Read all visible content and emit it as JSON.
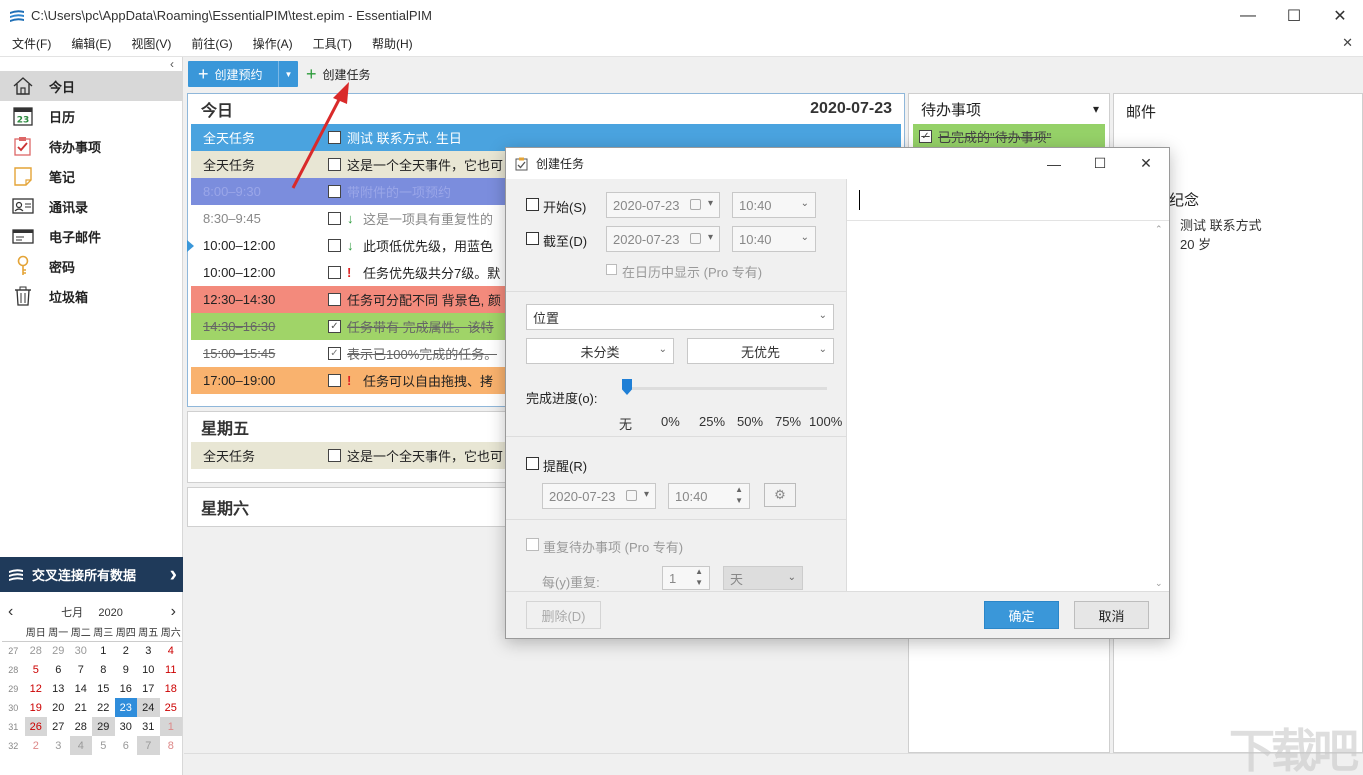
{
  "window": {
    "title": "C:\\Users\\pc\\AppData\\Roaming\\EssentialPIM\\test.epim - EssentialPIM",
    "minimize": "—",
    "maximize": "☐",
    "close": "✕"
  },
  "menu": [
    "文件(F)",
    "编辑(E)",
    "视图(V)",
    "前往(G)",
    "操作(A)",
    "工具(T)",
    "帮助(H)"
  ],
  "menu_close": "✕",
  "sidebar": {
    "collapse": "‹",
    "items": [
      {
        "label": "今日",
        "icon": "home-icon"
      },
      {
        "label": "日历",
        "icon": "calendar-icon",
        "badge": "23"
      },
      {
        "label": "待办事项",
        "icon": "todo-icon"
      },
      {
        "label": "笔记",
        "icon": "note-icon"
      },
      {
        "label": "通讯录",
        "icon": "contacts-icon"
      },
      {
        "label": "电子邮件",
        "icon": "email-icon"
      },
      {
        "label": "密码",
        "icon": "key-icon"
      },
      {
        "label": "垃圾箱",
        "icon": "trash-icon"
      }
    ],
    "sync_label": "交叉连接所有数据",
    "sync_arrow": "›"
  },
  "mini_calendar": {
    "prev": "‹",
    "next": "›",
    "month": "七月",
    "year": "2020",
    "weekdays": [
      "周日",
      "周一",
      "周二",
      "周三",
      "周四",
      "周五",
      "周六"
    ],
    "weeks": [
      {
        "wk": "27",
        "days": [
          "28",
          "29",
          "30",
          "1",
          "2",
          "3",
          "4"
        ]
      },
      {
        "wk": "28",
        "days": [
          "5",
          "6",
          "7",
          "8",
          "9",
          "10",
          "11"
        ]
      },
      {
        "wk": "29",
        "days": [
          "12",
          "13",
          "14",
          "15",
          "16",
          "17",
          "18"
        ]
      },
      {
        "wk": "30",
        "days": [
          "19",
          "20",
          "21",
          "22",
          "23",
          "24",
          "25"
        ]
      },
      {
        "wk": "31",
        "days": [
          "26",
          "27",
          "28",
          "29",
          "30",
          "31",
          "1"
        ]
      },
      {
        "wk": "32",
        "days": [
          "2",
          "3",
          "4",
          "5",
          "6",
          "7",
          "8"
        ]
      }
    ]
  },
  "toolbar": {
    "new_appointment": "创建预约",
    "new_task": "创建任务"
  },
  "today": {
    "title": "今日",
    "date": "2020-07-23",
    "rows": [
      {
        "time": "全天任务",
        "text": "测试 联系方式. 生日",
        "bg": "#4aa3df",
        "color": "#ffffff",
        "checked": false,
        "priority": ""
      },
      {
        "time": "全天任务",
        "text": "这是一个全天事件，它也可",
        "bg": "#e8e6d4",
        "color": "#222222",
        "checked": false,
        "priority": ""
      },
      {
        "time": "8:00–9:30",
        "text": "带附件的一项预约",
        "bg": "#7b8ddd",
        "color": "#9aa6e8",
        "checked": false,
        "priority": ""
      },
      {
        "time": "8:30–9:45",
        "text": "这是一项具有重复性的",
        "bg": "#ffffff",
        "color": "#888888",
        "checked": false,
        "priority": "↓"
      },
      {
        "time": "10:00–12:00",
        "text": "此项低优先级，用蓝色",
        "bg": "#ffffff",
        "color": "#222222",
        "checked": false,
        "priority": "↓"
      },
      {
        "time": "10:00–12:00",
        "text": "任务优先级共分7级。默",
        "bg": "#ffffff",
        "color": "#222222",
        "checked": false,
        "priority": "!"
      },
      {
        "time": "12:30–14:30",
        "text": "任务可分配不同 背景色, 颜",
        "bg": "#f38a7c",
        "color": "#222222",
        "checked": false,
        "priority": ""
      },
      {
        "time": "14:30–16:30",
        "text": "任务带有 完成属性。该特",
        "bg": "#a0d468",
        "color": "#555555",
        "checked": true,
        "priority": "",
        "strike": true
      },
      {
        "time": "15:00–15:45",
        "text": "表示已100%完成的任务。",
        "bg": "#ffffff",
        "color": "#777777",
        "checked": true,
        "priority": "",
        "strike": true
      },
      {
        "time": "17:00–19:00",
        "text": "任务可以自由拖拽、拷",
        "bg": "#f9b26e",
        "color": "#222222",
        "checked": false,
        "priority": "!"
      }
    ]
  },
  "friday": {
    "title": "星期五",
    "row_time": "全天任务",
    "row_text": "这是一个全天事件，它也可"
  },
  "saturday": {
    "title": "星期六"
  },
  "todo_panel": {
    "title": "待办事项",
    "dropdown": "▾",
    "item": "已完成的\"待办事项\"",
    "check": "✓"
  },
  "mail_panel": {
    "title": "邮件",
    "anniversary": "纪念",
    "contact": "测试 联系方式",
    "age": "20 岁"
  },
  "dialog": {
    "title": "创建任务",
    "minimize": "—",
    "maximize": "☐",
    "close": "✕",
    "start_label": "开始(S)",
    "start_date": "2020-07-23",
    "start_time": "10:40",
    "due_label": "截至(D)",
    "due_date": "2020-07-23",
    "due_time": "10:40",
    "show_in_calendar": "在日历中显示 (Pro 专有)",
    "location_placeholder": "位置",
    "category": "未分类",
    "priority": "无优先",
    "progress_label": "完成进度(o):",
    "progress_value": 0,
    "progress_ticks": [
      "无",
      "0%",
      "25%",
      "50%",
      "75%",
      "100%"
    ],
    "reminder_label": "提醒(R)",
    "reminder_date": "2020-07-23",
    "reminder_time": "10:40",
    "repeat_label": "重复待办事项 (Pro 专有)",
    "repeat_every_label": "每(y)重复:",
    "repeat_count": "1",
    "repeat_unit": "天",
    "delete_button": "删除(D)",
    "ok_button": "确定",
    "cancel_button": "取消"
  },
  "watermark": "下载吧"
}
